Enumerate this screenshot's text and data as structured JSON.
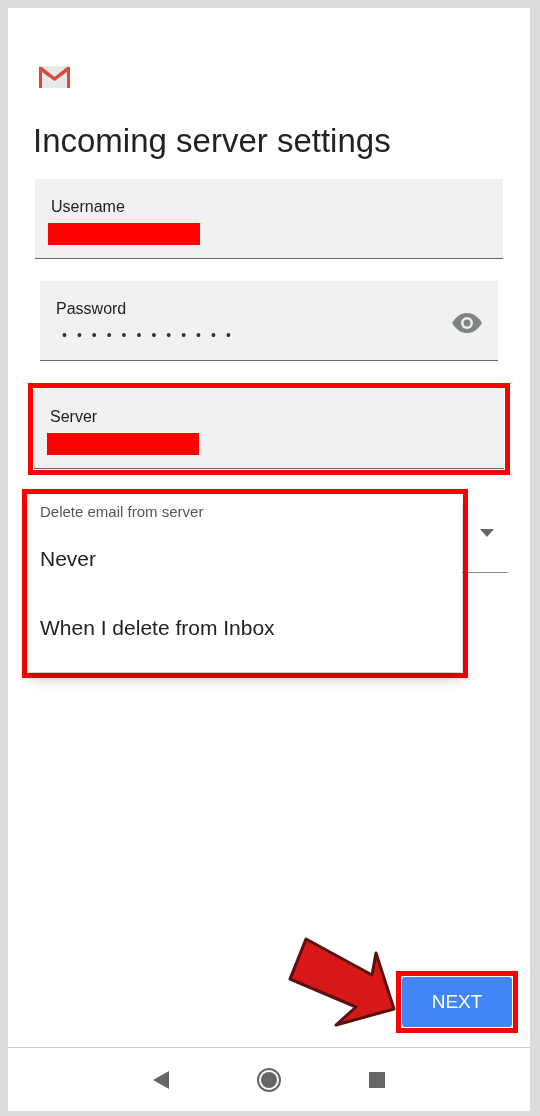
{
  "title": "Incoming server settings",
  "fields": [
    {
      "kind": "text",
      "label": "Username"
    },
    {
      "kind": "password",
      "label": "Password",
      "value": "••••••••••••"
    },
    {
      "kind": "text",
      "label": "Server",
      "highlighted": true
    },
    {
      "kind": "select",
      "menu": {
        "title": "Delete email from server",
        "highlighted": true,
        "options": [
          "Never",
          "When I delete from Inbox"
        ]
      }
    }
  ],
  "next_button": {
    "label": "NEXT",
    "highlighted": true
  }
}
